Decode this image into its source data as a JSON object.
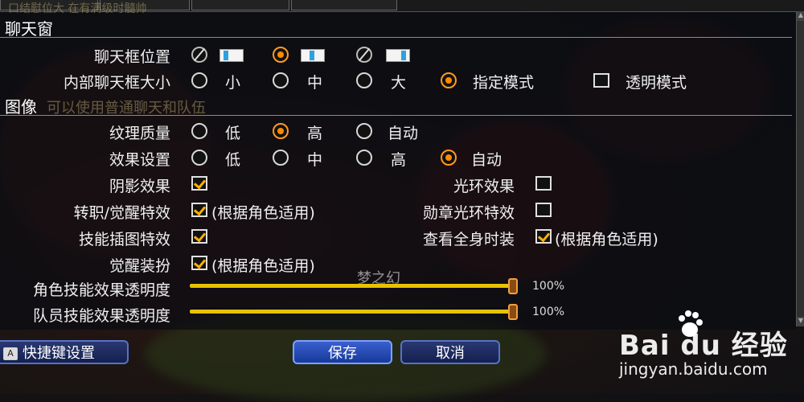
{
  "header_ghost_text": "口结慰位大 在有满级时髓帅",
  "sections": {
    "chat": "聊天窗",
    "graphics": "图像"
  },
  "chat_position": {
    "label": "聊天框位置",
    "options": [
      {
        "state": "disabled"
      },
      {
        "state": "selected"
      },
      {
        "state": "disabled"
      }
    ]
  },
  "chat_size": {
    "label": "内部聊天框大小",
    "options": [
      "小",
      "中",
      "大",
      "指定模式"
    ],
    "selected": "指定模式",
    "transparent_label": "透明模式",
    "transparent_checked": false
  },
  "ghost_chat_text": "可以使用普通聊天和队伍",
  "texture_quality": {
    "label": "纹理质量",
    "options": [
      "低",
      "高",
      "自动"
    ],
    "selected": "高"
  },
  "effect_settings": {
    "label": "效果设置",
    "options": [
      "低",
      "中",
      "高",
      "自动"
    ],
    "selected": "自动"
  },
  "shadow_effect": {
    "label": "阴影效果",
    "checked": true
  },
  "halo_effect": {
    "label": "光环效果",
    "checked": false
  },
  "transfer_effect": {
    "label": "转职/觉醒特效",
    "checked": true,
    "note": "(根据角色适用)"
  },
  "medal_effect": {
    "label": "勋章光环特效",
    "checked": false
  },
  "skill_illust": {
    "label": "技能插图特效",
    "checked": true
  },
  "full_costume": {
    "label": "查看全身时装",
    "checked": true,
    "note": "(根据角色适用)"
  },
  "awakening_outfit": {
    "label": "觉醒装扮",
    "checked": true,
    "note": "(根据角色适用)"
  },
  "char_skill_alpha": {
    "label": "角色技能效果透明度",
    "value": 100,
    "value_text": "100%"
  },
  "party_skill_alpha": {
    "label": "队员技能效果透明度",
    "value": 100,
    "value_text": "100%"
  },
  "game_name_text": "梦之幻",
  "buttons": {
    "hotkey": "快捷键设置",
    "hotkey_icon": "A",
    "save": "保存",
    "cancel": "取消"
  },
  "watermark": {
    "brand": "Bai du 经验",
    "url": "jingyan.baidu.com"
  },
  "colors": {
    "accent_orange": "#ff8a00",
    "slider_yellow": "#e6c200",
    "button_blue": "#2a4fb8"
  }
}
